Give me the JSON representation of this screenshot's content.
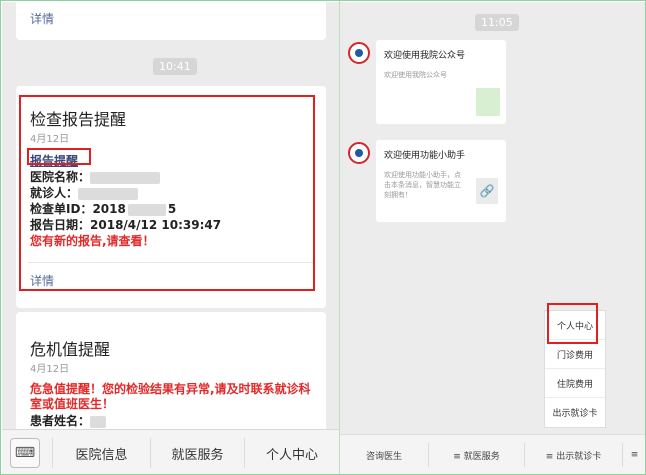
{
  "left": {
    "top_card": {
      "detail": "详情"
    },
    "time": "10:41",
    "report_card": {
      "title": "检查报告提醒",
      "date": "4月12日",
      "reminder_label": "报告提醒",
      "hospital_label": "医院名称：",
      "patient_label": "就诊人：",
      "check_id_label": "检查单ID：",
      "check_id_value": "2018",
      "check_id_suffix": "5",
      "report_date_label": "报告日期：",
      "report_date_value": "2018/4/12 10:39:47",
      "new_report_text": "您有新的报告,请查看！",
      "detail": "详情"
    },
    "crit_card": {
      "title": "危机值提醒",
      "date": "4月12日",
      "alert_text": "危急值提醒！您的检验结果有异常,请及时联系就诊科室或值班医生！",
      "patient_label": "患者姓名："
    },
    "bottombar": {
      "keyboard_icon": "keyboard-icon",
      "items": [
        "医院信息",
        "就医服务",
        "个人中心"
      ]
    }
  },
  "right": {
    "time": "11:05",
    "messages": [
      {
        "title": "欢迎使用我院公众号",
        "desc": "欢迎使用我院公众号"
      },
      {
        "title": "欢迎使用功能小助手",
        "desc": "欢迎使用功能小助手，点击本条消息，智慧功能立刻拥有！"
      }
    ],
    "menu": [
      "个人中心",
      "门诊费用",
      "住院费用",
      "出示就诊卡"
    ],
    "bottombar": [
      "咨询医生",
      "≡ 就医服务",
      "≡ 出示就诊卡",
      "≡"
    ]
  },
  "colors": {
    "highlight": "#e0201f",
    "link": "#576b95",
    "alert": "#e3292a"
  }
}
